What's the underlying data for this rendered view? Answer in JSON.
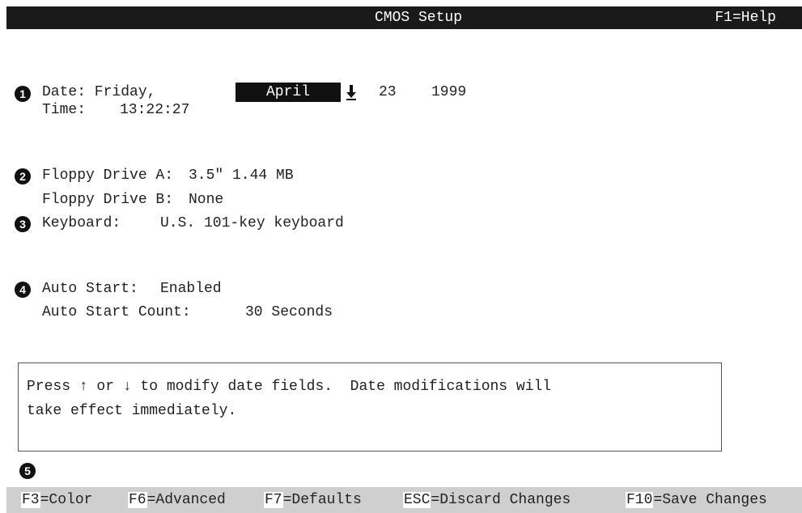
{
  "header": {
    "title": "CMOS Setup",
    "help": "F1=Help"
  },
  "callouts": [
    "1",
    "2",
    "3",
    "4",
    "5"
  ],
  "date": {
    "label": "Date: Friday,",
    "month": "April",
    "day": "23",
    "year": "1999",
    "adjust_icon": "down-arrow-icon"
  },
  "time": {
    "label": "Time:",
    "value": "13:22:27"
  },
  "floppy": {
    "a_label": "Floppy Drive A:",
    "a_value": "3.5\" 1.44 MB",
    "b_label": "Floppy Drive B:",
    "b_value": "None"
  },
  "keyboard": {
    "label": "Keyboard:",
    "value": "U.S. 101-key keyboard"
  },
  "autostart": {
    "label": "Auto Start:",
    "value": "Enabled",
    "count_label": "Auto Start Count:",
    "count_value": "30 Seconds"
  },
  "help_box": {
    "line1": "Press ↑ or ↓ to modify date fields.  Date modifications will",
    "line2": "take effect immediately."
  },
  "footer": {
    "f3": {
      "key": "F3",
      "label": "=Color"
    },
    "f6": {
      "key": "F6",
      "label": "=Advanced"
    },
    "f7": {
      "key": "F7",
      "label": "=Defaults"
    },
    "esc": {
      "key": "ESC",
      "label": "=Discard Changes"
    },
    "f10": {
      "key": "F10",
      "label": "=Save Changes"
    }
  }
}
